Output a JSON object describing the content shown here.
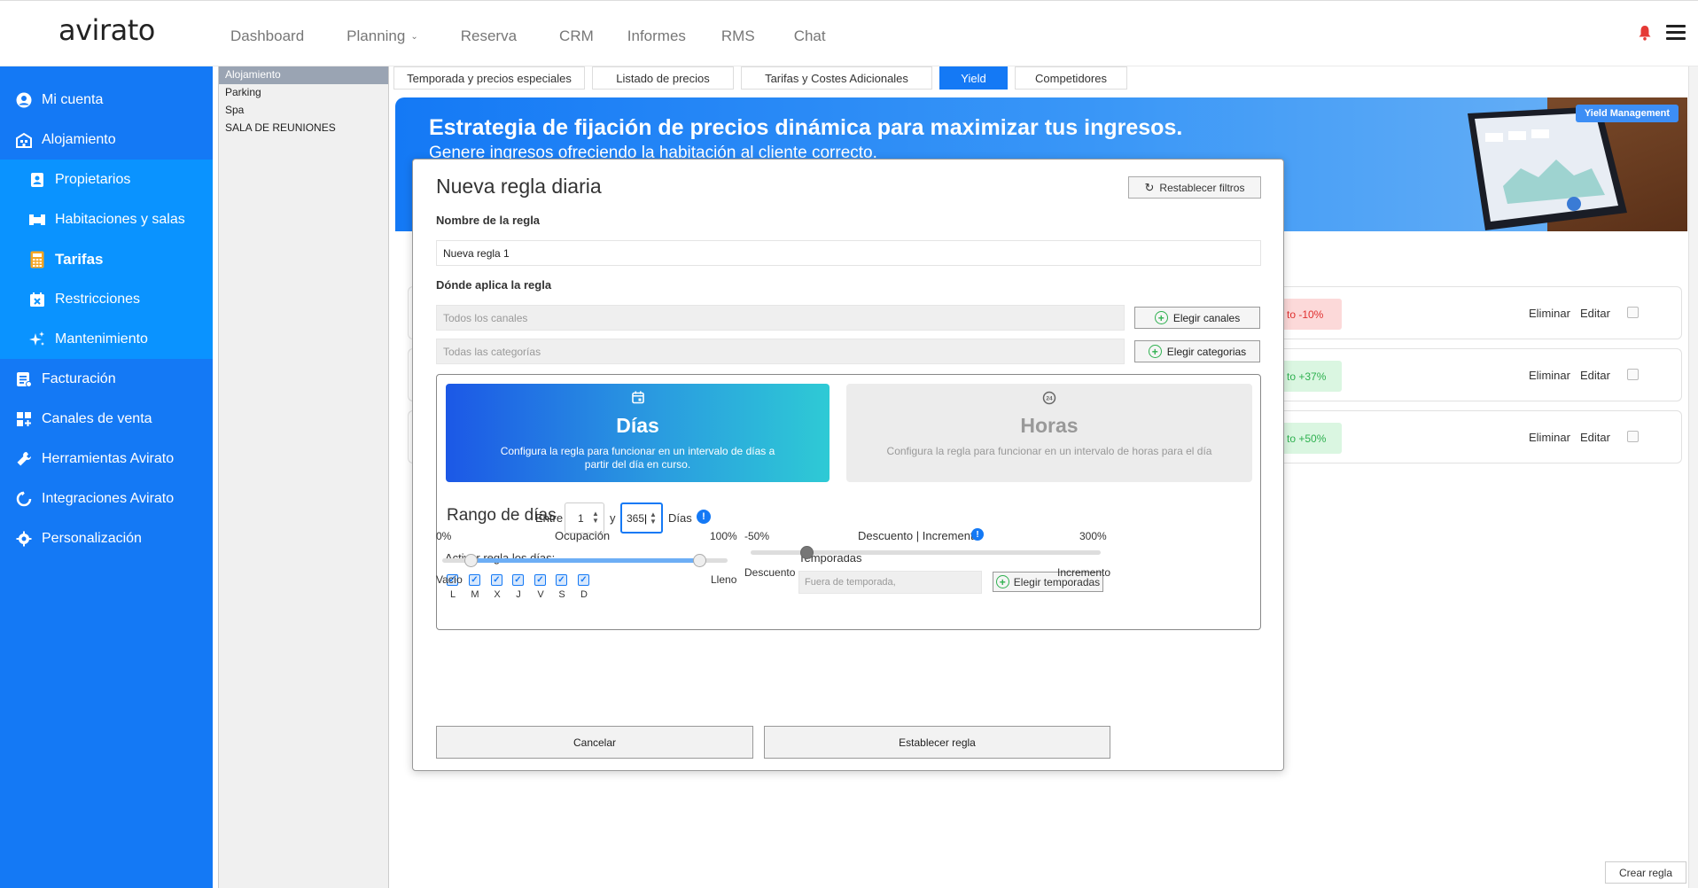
{
  "app": {
    "logo": "avirato"
  },
  "topnav": [
    "Dashboard",
    "Planning",
    "Reserva",
    "CRM",
    "Informes",
    "RMS",
    "Chat"
  ],
  "sidebar": {
    "items": [
      {
        "label": "Mi cuenta",
        "icon": "user-circle-icon"
      },
      {
        "label": "Alojamiento",
        "icon": "hotel-icon"
      },
      {
        "label": "Propietarios",
        "icon": "owner-badge-icon"
      },
      {
        "label": "Habitaciones y salas",
        "icon": "bed-icon"
      },
      {
        "label": "Tarifas",
        "icon": "calculator-icon"
      },
      {
        "label": "Restricciones",
        "icon": "calendar-x-icon"
      },
      {
        "label": "Mantenimiento",
        "icon": "sparkle-icon"
      },
      {
        "label": "Facturación",
        "icon": "invoice-icon"
      },
      {
        "label": "Canales de venta",
        "icon": "grid-plus-icon"
      },
      {
        "label": "Herramientas Avirato",
        "icon": "wrench-icon"
      },
      {
        "label": "Integraciones Avirato",
        "icon": "refresh-icon"
      },
      {
        "label": "Personalización",
        "icon": "gear-icon"
      }
    ]
  },
  "sublist": [
    "Alojamiento",
    "Parking",
    "Spa",
    "SALA DE REUNIONES"
  ],
  "tabs": [
    "Temporada y precios especiales",
    "Listado de precios",
    "Tarifas y  Costes Adicionales",
    "Yield",
    "Competidores"
  ],
  "banner": {
    "title": "Estrategia de fijación de precios dinámica para maximizar tus ingresos.",
    "subtitle": "Genere ingresos ofreciendo la habitación al cliente correcto.",
    "badge": "Yield Management"
  },
  "rules": [
    {
      "badge": "to -10%",
      "color": "#e0302f",
      "delete": "Eliminar",
      "edit": "Editar"
    },
    {
      "badge": "to +37%",
      "color": "#2fb150",
      "delete": "Eliminar",
      "edit": "Editar"
    },
    {
      "badge": "to +50%",
      "color": "#2fb150",
      "delete": "Eliminar",
      "edit": "Editar"
    }
  ],
  "crear_regla": "Crear regla",
  "modal": {
    "title": "Nueva regla diaria",
    "reset": "Restablecer filtros",
    "name_label": "Nombre de la regla",
    "name_value": "Nueva regla 1",
    "where_label": "Dónde aplica la regla",
    "channels_placeholder": "Todos los canales",
    "channels_btn": "Elegir canales",
    "categories_placeholder": "Todas las categorías",
    "categories_btn": "Elegir categorias",
    "dias": {
      "name": "Días",
      "desc": "Configura la regla para funcionar en un intervalo de días a partir del día en curso."
    },
    "horas": {
      "name": "Horas",
      "desc": "Configura la regla para funcionar en un intervalo de horas para el día"
    },
    "rango_label": "Rango de días",
    "entre": "Entre",
    "from": "1",
    "y": "y",
    "to": "365",
    "dias_unit": "Días",
    "activar_label": "Activar regla los días:",
    "days": [
      "L",
      "M",
      "X",
      "J",
      "V",
      "S",
      "D"
    ],
    "temporadas_label": "Temporadas",
    "temporada_placeholder": "Fuera de temporada,",
    "temporadas_btn": "Elegir temporadas",
    "ocupacion": {
      "label": "Ocupación",
      "min": "0%",
      "max": "100%",
      "left": "Vacío",
      "right": "Lleno",
      "low": 0.1,
      "high": 0.9
    },
    "descuento": {
      "label": "Descuento | Incremento",
      "min": "-50%",
      "max": "300%",
      "left": "Descuento",
      "right": "Incremento",
      "value": 0.16
    },
    "cancel": "Cancelar",
    "submit": "Establecer regla"
  }
}
